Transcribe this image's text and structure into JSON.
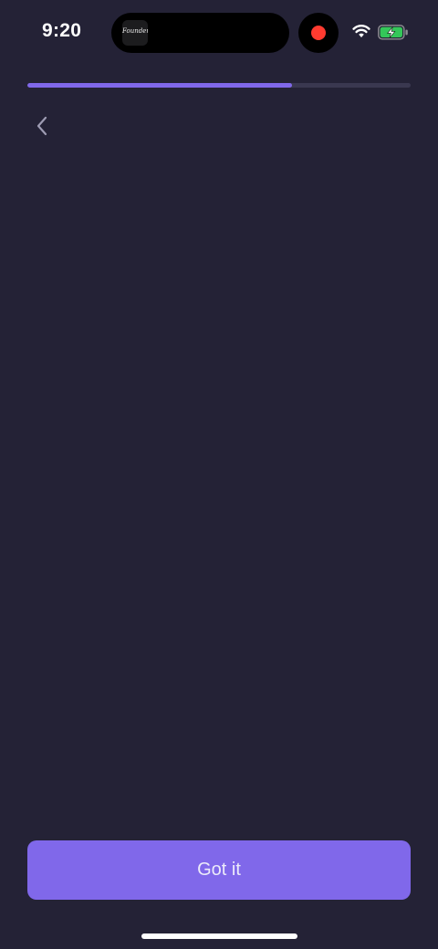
{
  "status_bar": {
    "time": "9:20",
    "island_app_label": "Founders",
    "recording_color": "#ff3b30"
  },
  "progress": {
    "fraction": 0.69,
    "fill_color": "#8068ea",
    "track_color": "#3a3850"
  },
  "navigation": {
    "back_icon": "chevron-left-icon"
  },
  "footer": {
    "primary_button_label": "Got it",
    "button_color": "#8068ea"
  },
  "theme": {
    "background": "#242236"
  }
}
